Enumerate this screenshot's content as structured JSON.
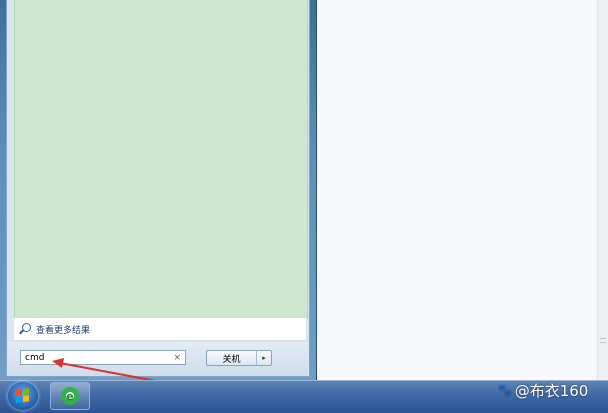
{
  "start_menu": {
    "more_results_label": "查看更多结果",
    "search": {
      "value": "cmd",
      "clear_glyph": "×"
    },
    "shutdown": {
      "label": "关机",
      "arrow_glyph": "▸"
    }
  },
  "taskbar": {
    "pinned": [
      {
        "name": "internet-explorer",
        "icon": "ie-icon"
      }
    ],
    "start_icon": "windows-flag-icon"
  },
  "watermark": {
    "icon_glyph": "🐾",
    "text": "@布衣160"
  },
  "colors": {
    "results_pane": "#cde8cf",
    "annotation_arrow": "#d9302c",
    "taskbar": "#3f69a4"
  }
}
